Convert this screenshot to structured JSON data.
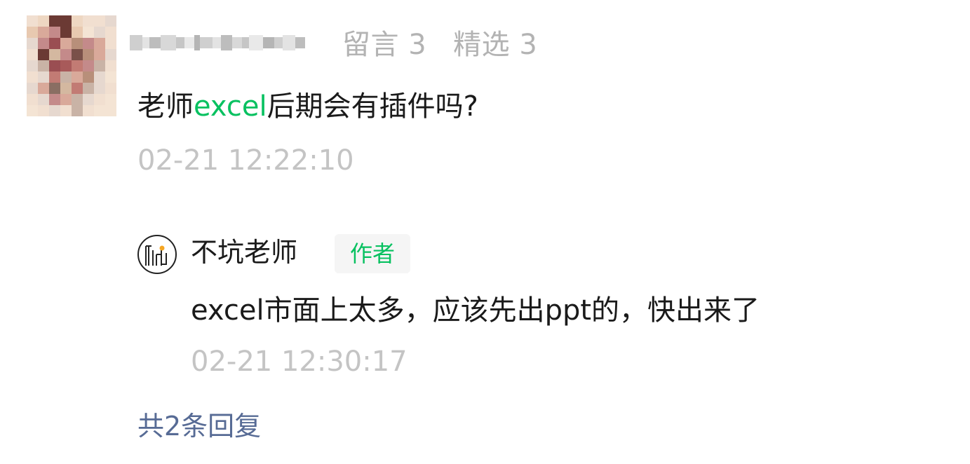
{
  "comment": {
    "stats": {
      "messages": "留言 3",
      "selected": "精选 3"
    },
    "text_before": "老师",
    "text_highlight": "excel",
    "text_after": "后期会有插件吗?",
    "time": "02-21 12:22:10",
    "highlight_color": "#07c160"
  },
  "reply": {
    "author": "不坑老师",
    "badge": "作者",
    "text": "excel市面上太多，应该先出ppt的，快出来了",
    "time": "02-21 12:30:17"
  },
  "more_replies": "共2条回复",
  "colors": {
    "link": "#576b95",
    "secondary": "#b3b3b3",
    "badge_bg": "#f5f5f5"
  }
}
